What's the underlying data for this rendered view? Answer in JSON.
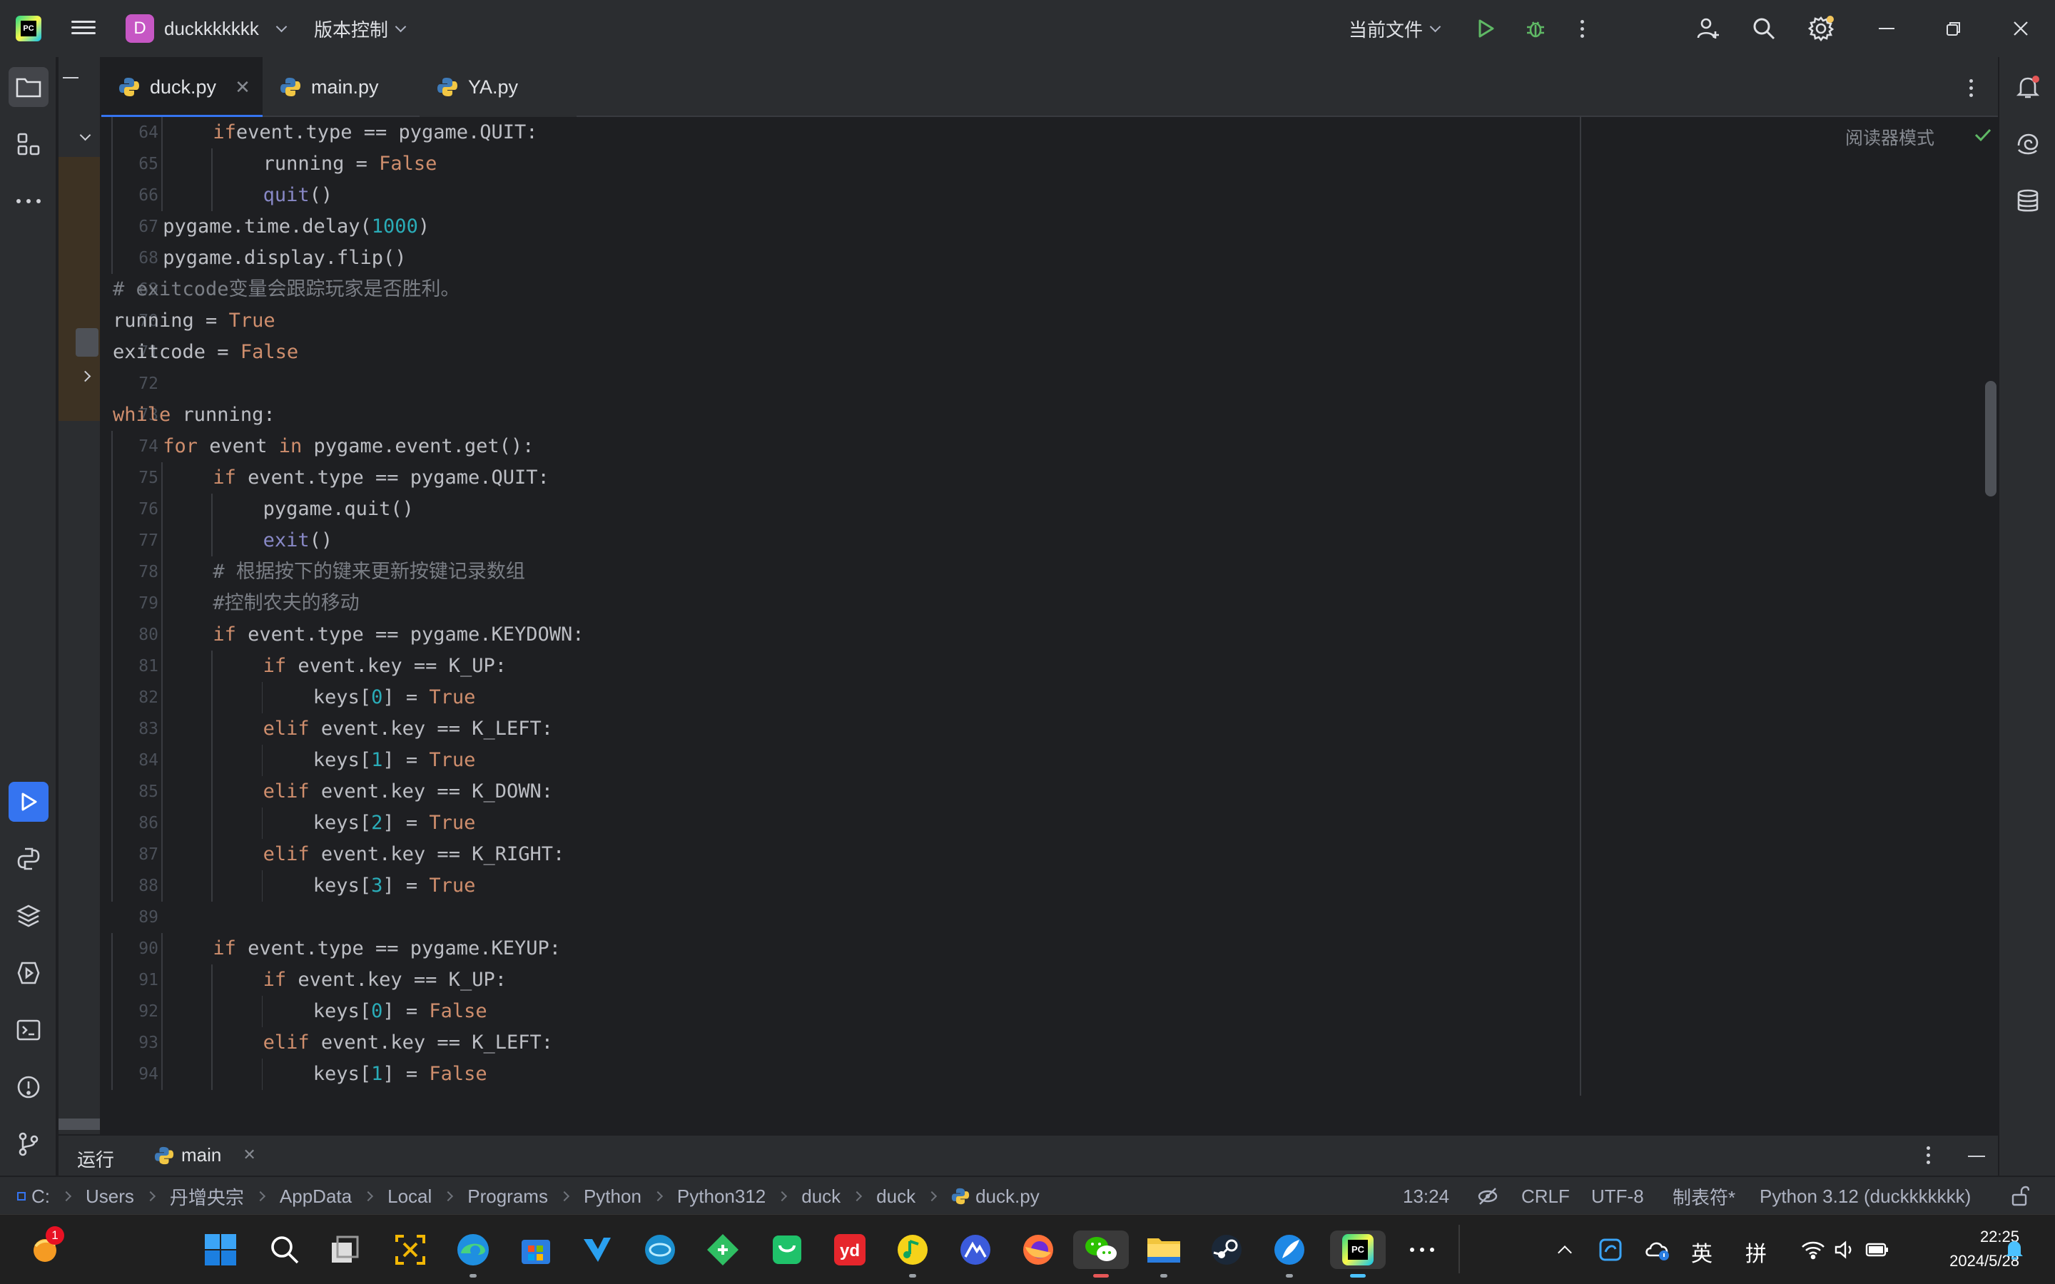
{
  "titlebar": {
    "project_initial": "D",
    "project_name": "duckkkkkkk",
    "vcs_label": "版本控制",
    "run_config": "当前文件"
  },
  "tabs": [
    {
      "label": "duck.py",
      "active": true
    },
    {
      "label": "main.py",
      "active": false
    },
    {
      "label": "YA.py",
      "active": false
    }
  ],
  "editor": {
    "reader_mode": "阅读器模式",
    "lines": [
      {
        "n": "64",
        "indent": 2,
        "parts": [
          [
            "kw",
            "if"
          ],
          [
            "",
            "event.type == pygame.QUIT:"
          ]
        ]
      },
      {
        "n": "65",
        "indent": 3,
        "parts": [
          [
            "",
            "running = "
          ],
          [
            "kw",
            "False"
          ]
        ]
      },
      {
        "n": "66",
        "indent": 3,
        "parts": [
          [
            "bi",
            "quit"
          ],
          [
            "",
            "()"
          ]
        ]
      },
      {
        "n": "67",
        "indent": 1,
        "parts": [
          [
            "",
            "pygame.time.delay("
          ],
          [
            "num",
            "1000"
          ],
          [
            "",
            ")"
          ]
        ]
      },
      {
        "n": "68",
        "indent": 1,
        "parts": [
          [
            "",
            "pygame.display.flip()"
          ]
        ]
      },
      {
        "n": "69",
        "indent": 0,
        "parts": [
          [
            "cm",
            "# exitcode变量会跟踪玩家是否胜利。"
          ]
        ]
      },
      {
        "n": "70",
        "indent": 0,
        "parts": [
          [
            "",
            "running = "
          ],
          [
            "kw",
            "True"
          ]
        ]
      },
      {
        "n": "71",
        "indent": 0,
        "parts": [
          [
            "",
            "exitcode = "
          ],
          [
            "kw",
            "False"
          ]
        ]
      },
      {
        "n": "72",
        "indent": 0,
        "parts": []
      },
      {
        "n": "73",
        "indent": 0,
        "parts": [
          [
            "kw",
            "while"
          ],
          [
            "",
            " running:"
          ]
        ]
      },
      {
        "n": "74",
        "indent": 1,
        "parts": [
          [
            "kw",
            "for"
          ],
          [
            "",
            " event "
          ],
          [
            "kw",
            "in"
          ],
          [
            "",
            " pygame.event.get():"
          ]
        ]
      },
      {
        "n": "75",
        "indent": 2,
        "parts": [
          [
            "kw",
            "if"
          ],
          [
            "",
            " event.type == pygame.QUIT:"
          ]
        ]
      },
      {
        "n": "76",
        "indent": 3,
        "parts": [
          [
            "",
            "pygame.quit()"
          ]
        ]
      },
      {
        "n": "77",
        "indent": 3,
        "parts": [
          [
            "bi",
            "exit"
          ],
          [
            "",
            "()"
          ]
        ]
      },
      {
        "n": "78",
        "indent": 2,
        "parts": [
          [
            "cm",
            "# 根据按下的键来更新按键记录数组"
          ]
        ]
      },
      {
        "n": "79",
        "indent": 2,
        "parts": [
          [
            "cm",
            "#控制农夫的移动"
          ]
        ]
      },
      {
        "n": "80",
        "indent": 2,
        "parts": [
          [
            "kw",
            "if"
          ],
          [
            "",
            " event.type == pygame.KEYDOWN:"
          ]
        ]
      },
      {
        "n": "81",
        "indent": 3,
        "parts": [
          [
            "kw",
            "if"
          ],
          [
            "",
            " event.key == K_UP:"
          ]
        ]
      },
      {
        "n": "82",
        "indent": 4,
        "parts": [
          [
            "",
            "keys["
          ],
          [
            "num",
            "0"
          ],
          [
            "",
            "] = "
          ],
          [
            "kw",
            "True"
          ]
        ]
      },
      {
        "n": "83",
        "indent": 3,
        "parts": [
          [
            "kw",
            "elif"
          ],
          [
            "",
            " event.key == K_LEFT:"
          ]
        ]
      },
      {
        "n": "84",
        "indent": 4,
        "parts": [
          [
            "",
            "keys["
          ],
          [
            "num",
            "1"
          ],
          [
            "",
            "] = "
          ],
          [
            "kw",
            "True"
          ]
        ]
      },
      {
        "n": "85",
        "indent": 3,
        "parts": [
          [
            "kw",
            "elif"
          ],
          [
            "",
            " event.key == K_DOWN:"
          ]
        ]
      },
      {
        "n": "86",
        "indent": 4,
        "parts": [
          [
            "",
            "keys["
          ],
          [
            "num",
            "2"
          ],
          [
            "",
            "] = "
          ],
          [
            "kw",
            "True"
          ]
        ]
      },
      {
        "n": "87",
        "indent": 3,
        "parts": [
          [
            "kw",
            "elif"
          ],
          [
            "",
            " event.key == K_RIGHT:"
          ]
        ]
      },
      {
        "n": "88",
        "indent": 4,
        "parts": [
          [
            "",
            "keys["
          ],
          [
            "num",
            "3"
          ],
          [
            "",
            "] = "
          ],
          [
            "kw",
            "True"
          ]
        ]
      },
      {
        "n": "89",
        "indent": 0,
        "parts": []
      },
      {
        "n": "90",
        "indent": 2,
        "parts": [
          [
            "kw",
            "if"
          ],
          [
            "",
            " event.type == pygame.KEYUP:"
          ]
        ]
      },
      {
        "n": "91",
        "indent": 3,
        "parts": [
          [
            "kw",
            "if"
          ],
          [
            "",
            " event.key == K_UP:"
          ]
        ]
      },
      {
        "n": "92",
        "indent": 4,
        "parts": [
          [
            "",
            "keys["
          ],
          [
            "num",
            "0"
          ],
          [
            "",
            "] = "
          ],
          [
            "kw",
            "False"
          ]
        ]
      },
      {
        "n": "93",
        "indent": 3,
        "parts": [
          [
            "kw",
            "elif"
          ],
          [
            "",
            " event.key == K_LEFT:"
          ]
        ]
      },
      {
        "n": "94",
        "indent": 4,
        "parts": [
          [
            "",
            "keys["
          ],
          [
            "num",
            "1"
          ],
          [
            "",
            "] = "
          ],
          [
            "kw",
            "False"
          ]
        ]
      }
    ]
  },
  "bottom_panel": {
    "run_label": "运行",
    "run_tab": "main"
  },
  "breadcrumbs": [
    "C:",
    "Users",
    "丹增央宗",
    "AppData",
    "Local",
    "Programs",
    "Python",
    "Python312",
    "duck",
    "duck",
    "duck.py"
  ],
  "status": {
    "position": "13:24",
    "line_sep": "CRLF",
    "encoding": "UTF-8",
    "indent": "制表符*",
    "interpreter": "Python 3.12 (duckkkkkkk)"
  },
  "taskbar": {
    "notification_count": "1",
    "ime_lang": "英",
    "ime_mode": "拼",
    "time": "22:25",
    "date": "2024/5/28"
  },
  "colors": {
    "accent": "#3574f0",
    "keyword": "#cf8e6d",
    "number": "#2aacb8",
    "comment": "#7a7e85"
  }
}
